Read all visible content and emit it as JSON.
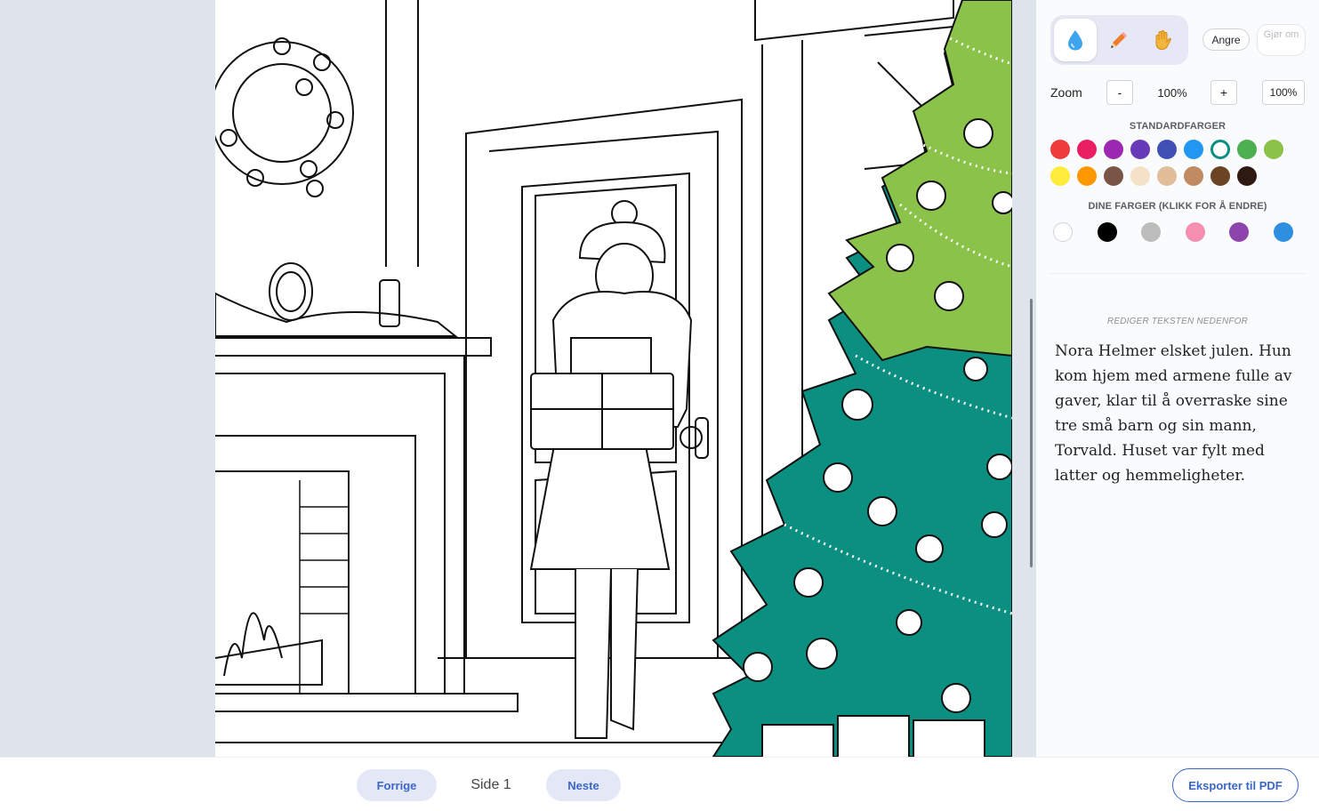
{
  "tools": [
    {
      "name": "fill-tool",
      "icon": "droplet-icon",
      "active": true
    },
    {
      "name": "pencil-tool",
      "icon": "pencil-icon",
      "active": false
    },
    {
      "name": "pan-tool",
      "icon": "hand-icon",
      "active": false
    }
  ],
  "toolbar": {
    "undo_label": "Angre",
    "redo_label": "Gjør om"
  },
  "zoom": {
    "label": "Zoom",
    "minus": "-",
    "value": "100%",
    "plus": "+",
    "reset": "100%"
  },
  "palette": {
    "standard_title": "STANDARDFARGER",
    "standard_colors": [
      "#ef3b3b",
      "#e91e63",
      "#9c27b0",
      "#673ab7",
      "#3f51b5",
      "#2196f3",
      "#0a8f80",
      "#4caf50",
      "#8bc34a",
      "#ffeb3b",
      "#ff9800",
      "#795548",
      "#f5e1c8",
      "#e2bd9a",
      "#c08a62",
      "#6b4423",
      "#2e1a12"
    ],
    "selected": "#0a8f80",
    "user_title": "DINE FARGER (KLIKK FOR Å ENDRE)",
    "user_colors": [
      "#ffffff",
      "#000000",
      "#bdbdbd",
      "#f48fb1",
      "#8e44ad",
      "#2e8ee0"
    ]
  },
  "story": {
    "label": "REDIGER TEKSTEN NEDENFOR",
    "text": "Nora Helmer elsket julen. Hun kom hjem med armene fulle av gaver, klar til å overraske sine tre små barn og sin mann, Torvald. Huset var fylt med latter og hemmeligheter."
  },
  "nav": {
    "prev_label": "Forrige",
    "page_label": "Side 1",
    "next_label": "Neste",
    "export_label": "Eksporter til PDF"
  },
  "colors": {
    "accent": "#3a66c6",
    "tree_teal": "#0a8f80",
    "tree_green": "#8bc34a",
    "background": "#dfe3ec"
  }
}
